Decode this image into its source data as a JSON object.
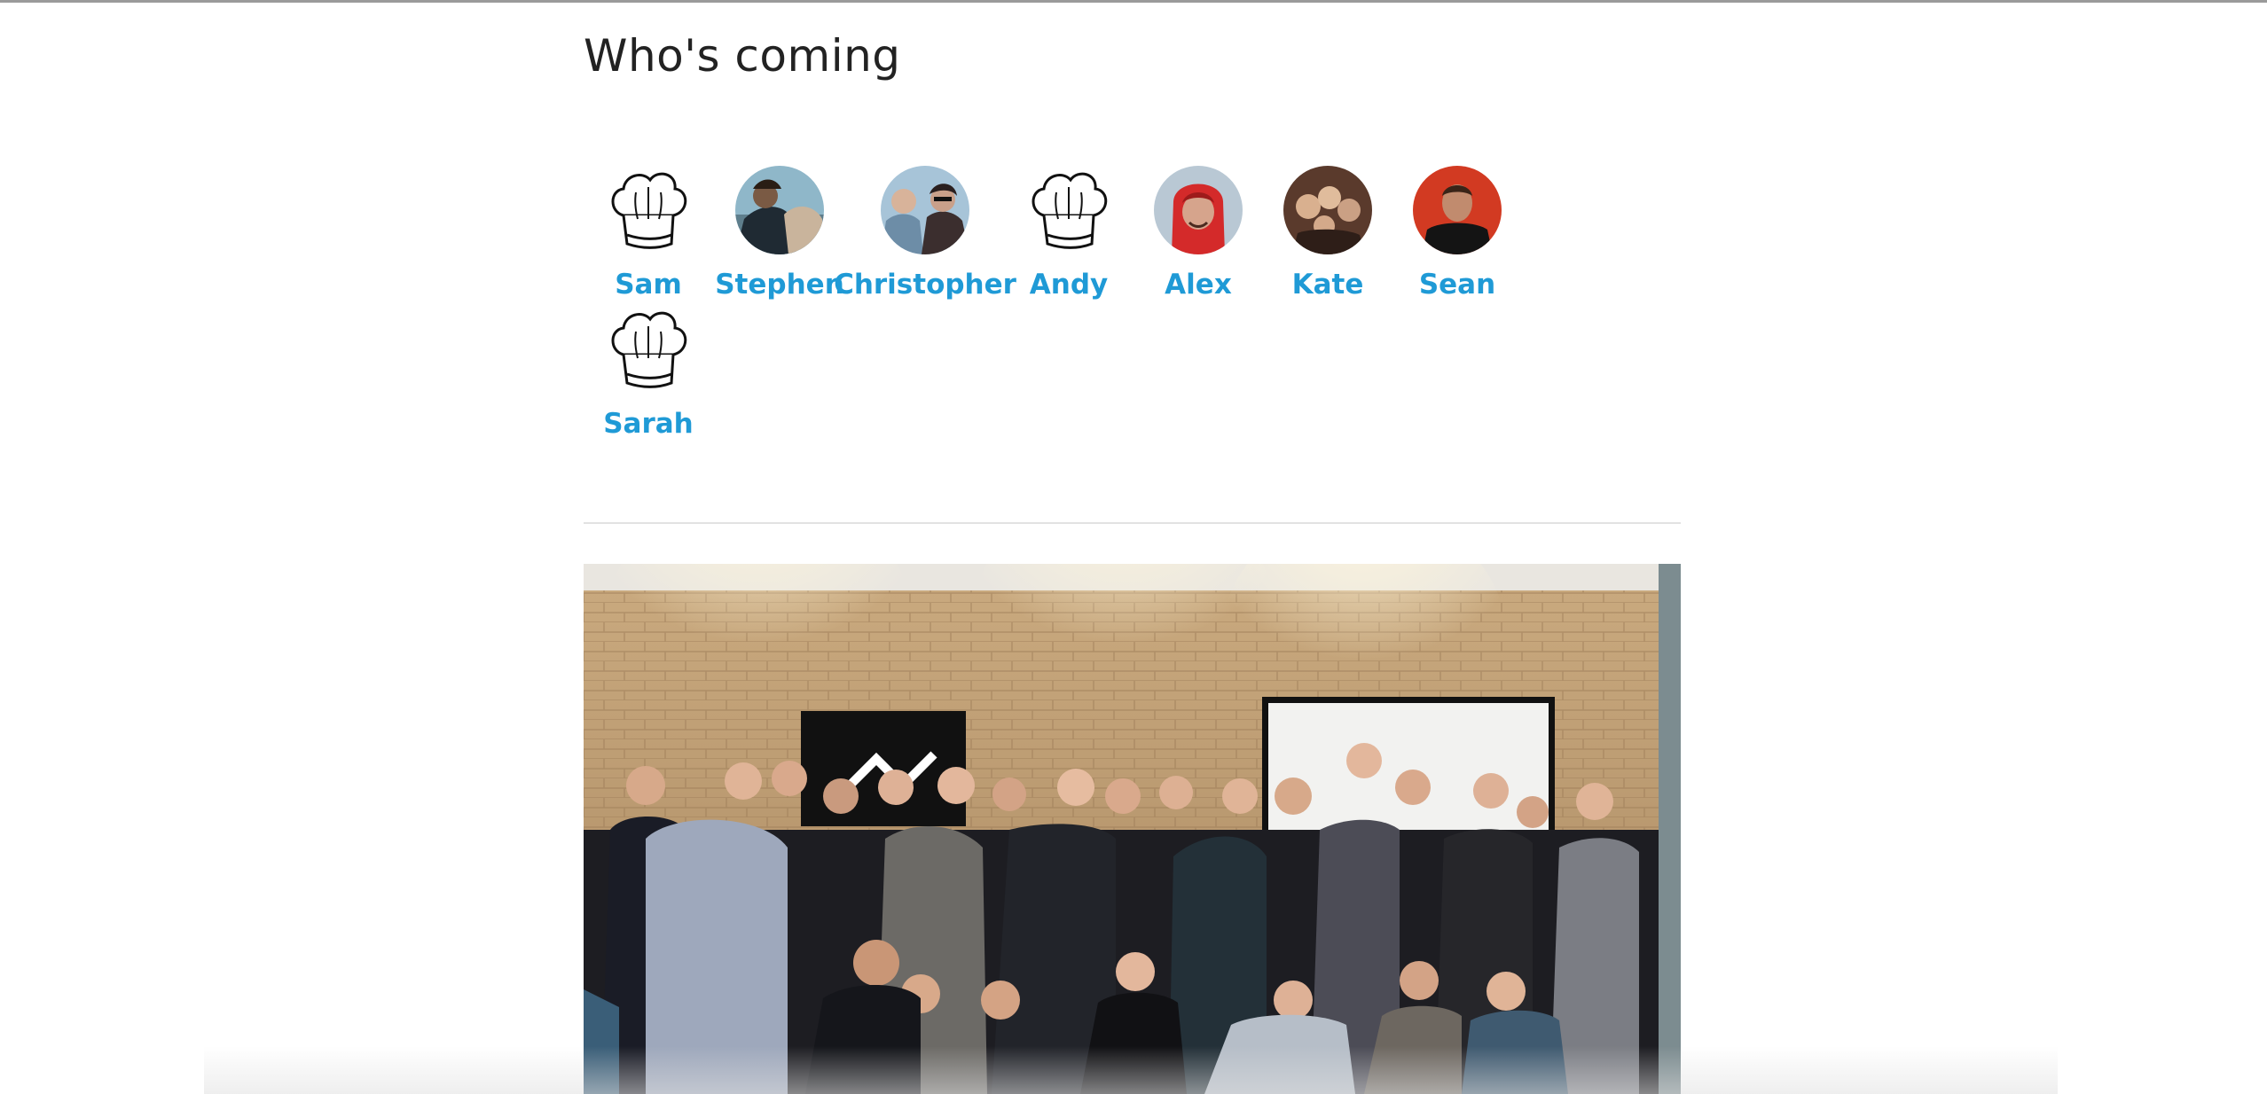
{
  "section": {
    "title": "Who's coming"
  },
  "attendees": [
    {
      "name": "Sam",
      "avatar": "chef-hat-icon"
    },
    {
      "name": "Stephen",
      "avatar": "photo"
    },
    {
      "name": "Christopher",
      "avatar": "photo"
    },
    {
      "name": "Andy",
      "avatar": "chef-hat-icon"
    },
    {
      "name": "Alex",
      "avatar": "photo"
    },
    {
      "name": "Kate",
      "avatar": "photo"
    },
    {
      "name": "Sean",
      "avatar": "photo"
    },
    {
      "name": "Sarah",
      "avatar": "chef-hat-icon"
    }
  ],
  "colors": {
    "link": "#1f9ad6",
    "title": "#222222",
    "divider": "#e2e2e2"
  }
}
